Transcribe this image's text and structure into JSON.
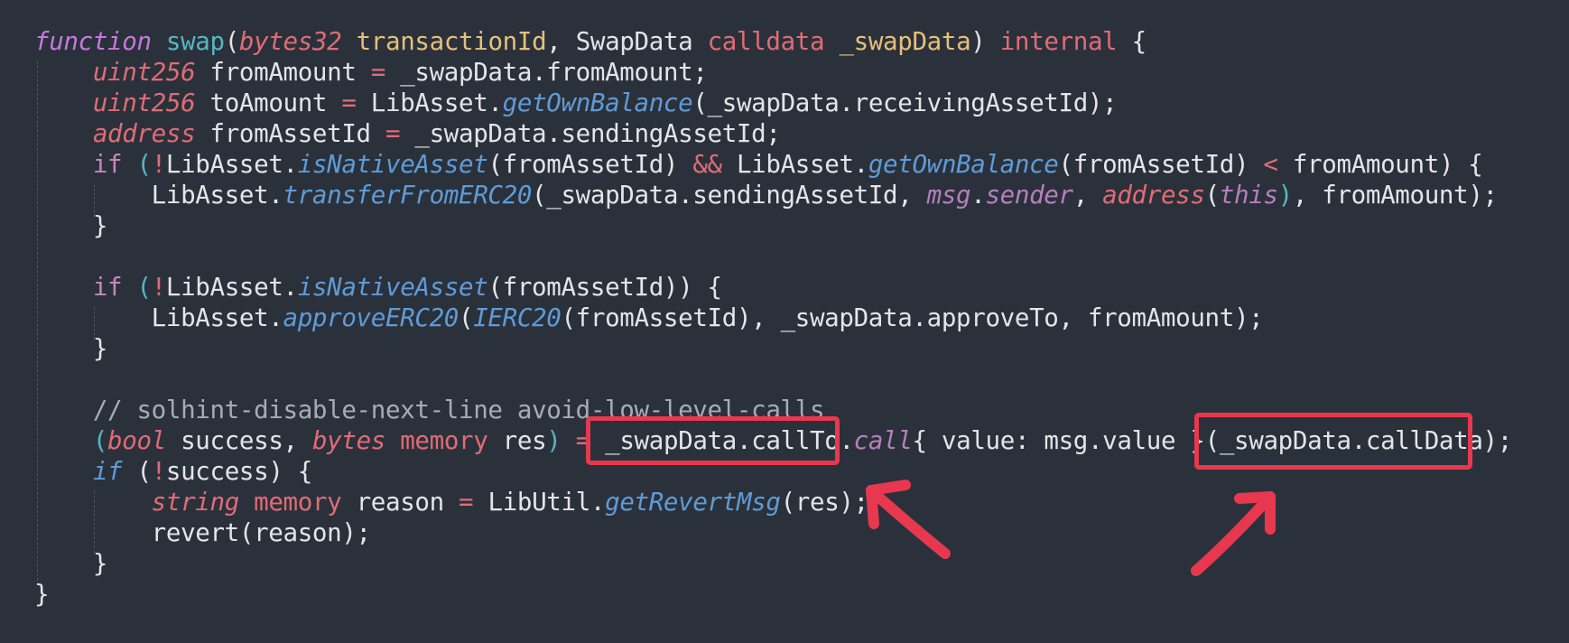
{
  "code": {
    "lines": [
      {
        "segments": [
          {
            "t": "function",
            "c": "t-kw-italic"
          },
          {
            "t": " ",
            "c": "t-plain"
          },
          {
            "t": "swap",
            "c": "t-fn"
          },
          {
            "t": "(",
            "c": "t-plain"
          },
          {
            "t": "bytes32",
            "c": "t-type"
          },
          {
            "t": " ",
            "c": "t-plain"
          },
          {
            "t": "transactionId",
            "c": "t-param"
          },
          {
            "t": ", SwapData ",
            "c": "t-plain"
          },
          {
            "t": "calldata",
            "c": "t-kw"
          },
          {
            "t": " ",
            "c": "t-plain"
          },
          {
            "t": "_swapData",
            "c": "t-param"
          },
          {
            "t": ") ",
            "c": "t-plain"
          },
          {
            "t": "internal",
            "c": "t-kw"
          },
          {
            "t": " {",
            "c": "t-plain"
          }
        ]
      },
      {
        "segments": [
          {
            "t": "    ",
            "c": "t-plain"
          },
          {
            "t": "uint256",
            "c": "t-type"
          },
          {
            "t": " fromAmount ",
            "c": "t-plain"
          },
          {
            "t": "=",
            "c": "t-op"
          },
          {
            "t": " _swapData.fromAmount;",
            "c": "t-plain"
          }
        ]
      },
      {
        "segments": [
          {
            "t": "    ",
            "c": "t-plain"
          },
          {
            "t": "uint256",
            "c": "t-type"
          },
          {
            "t": " toAmount ",
            "c": "t-plain"
          },
          {
            "t": "=",
            "c": "t-op"
          },
          {
            "t": " LibAsset.",
            "c": "t-plain"
          },
          {
            "t": "getOwnBalance",
            "c": "t-method"
          },
          {
            "t": "(_swapData.receivingAssetId);",
            "c": "t-plain"
          }
        ]
      },
      {
        "segments": [
          {
            "t": "    ",
            "c": "t-plain"
          },
          {
            "t": "address",
            "c": "t-type"
          },
          {
            "t": " fromAssetId ",
            "c": "t-plain"
          },
          {
            "t": "=",
            "c": "t-op"
          },
          {
            "t": " _swapData.sendingAssetId;",
            "c": "t-plain"
          }
        ]
      },
      {
        "segments": [
          {
            "t": "    ",
            "c": "t-plain"
          },
          {
            "t": "if",
            "c": "t-if"
          },
          {
            "t": " (",
            "c": "t-cyan"
          },
          {
            "t": "!",
            "c": "t-op"
          },
          {
            "t": "LibAsset.",
            "c": "t-plain"
          },
          {
            "t": "isNativeAsset",
            "c": "t-method"
          },
          {
            "t": "(fromAssetId) ",
            "c": "t-plain"
          },
          {
            "t": "&&",
            "c": "t-op"
          },
          {
            "t": " LibAsset.",
            "c": "t-plain"
          },
          {
            "t": "getOwnBalance",
            "c": "t-method"
          },
          {
            "t": "(fromAssetId) ",
            "c": "t-plain"
          },
          {
            "t": "<",
            "c": "t-op"
          },
          {
            "t": " fromAmount) {",
            "c": "t-plain"
          }
        ]
      },
      {
        "segments": [
          {
            "t": "        LibAsset.",
            "c": "t-plain"
          },
          {
            "t": "transferFromERC20",
            "c": "t-method"
          },
          {
            "t": "(_swapData.sendingAssetId, ",
            "c": "t-plain"
          },
          {
            "t": "msg",
            "c": "t-builtin"
          },
          {
            "t": ".",
            "c": "t-plain"
          },
          {
            "t": "sender",
            "c": "t-builtin"
          },
          {
            "t": ", ",
            "c": "t-plain"
          },
          {
            "t": "address",
            "c": "t-type"
          },
          {
            "t": "(",
            "c": "t-plain"
          },
          {
            "t": "this",
            "c": "t-builtin"
          },
          {
            "t": ")",
            "c": "t-cyan"
          },
          {
            "t": ", fromAmount);",
            "c": "t-plain"
          }
        ]
      },
      {
        "segments": [
          {
            "t": "    }",
            "c": "t-plain"
          }
        ]
      },
      {
        "segments": [
          {
            "t": "",
            "c": "t-plain"
          }
        ]
      },
      {
        "segments": [
          {
            "t": "    ",
            "c": "t-plain"
          },
          {
            "t": "if",
            "c": "t-if"
          },
          {
            "t": " (",
            "c": "t-cyan"
          },
          {
            "t": "!",
            "c": "t-op"
          },
          {
            "t": "LibAsset.",
            "c": "t-plain"
          },
          {
            "t": "isNativeAsset",
            "c": "t-method"
          },
          {
            "t": "(fromAssetId)) {",
            "c": "t-plain"
          }
        ]
      },
      {
        "segments": [
          {
            "t": "        LibAsset.",
            "c": "t-plain"
          },
          {
            "t": "approveERC20",
            "c": "t-method"
          },
          {
            "t": "(",
            "c": "t-plain"
          },
          {
            "t": "IERC20",
            "c": "t-method"
          },
          {
            "t": "(fromAssetId), _swapData.approveTo, fromAmount);",
            "c": "t-plain"
          }
        ]
      },
      {
        "segments": [
          {
            "t": "    }",
            "c": "t-plain"
          }
        ]
      },
      {
        "segments": [
          {
            "t": "",
            "c": "t-plain"
          }
        ]
      },
      {
        "segments": [
          {
            "t": "    ",
            "c": "t-plain"
          },
          {
            "t": "// solhint-disable-next-line avoid-low-level-calls",
            "c": "t-comment"
          }
        ]
      },
      {
        "segments": [
          {
            "t": "    ",
            "c": "t-plain"
          },
          {
            "t": "(",
            "c": "t-cyan"
          },
          {
            "t": "bool",
            "c": "t-type"
          },
          {
            "t": " success, ",
            "c": "t-plain"
          },
          {
            "t": "bytes",
            "c": "t-type"
          },
          {
            "t": " ",
            "c": "t-plain"
          },
          {
            "t": "memory",
            "c": "t-kw"
          },
          {
            "t": " res",
            "c": "t-plain"
          },
          {
            "t": ")",
            "c": "t-cyan"
          },
          {
            "t": " ",
            "c": "t-plain"
          },
          {
            "t": "=",
            "c": "t-op"
          },
          {
            "t": " _swapData.callTo.",
            "c": "t-plain"
          },
          {
            "t": "call",
            "c": "t-builtin"
          },
          {
            "t": "{ value: msg.value }(_swapData.callData);",
            "c": "t-plain"
          }
        ]
      },
      {
        "segments": [
          {
            "t": "    ",
            "c": "t-plain"
          },
          {
            "t": "if",
            "c": "t-ifit"
          },
          {
            "t": " (",
            "c": "t-plain"
          },
          {
            "t": "!",
            "c": "t-op"
          },
          {
            "t": "success) {",
            "c": "t-plain"
          }
        ]
      },
      {
        "segments": [
          {
            "t": "        ",
            "c": "t-plain"
          },
          {
            "t": "string",
            "c": "t-type"
          },
          {
            "t": " ",
            "c": "t-plain"
          },
          {
            "t": "memory",
            "c": "t-kw"
          },
          {
            "t": " reason ",
            "c": "t-plain"
          },
          {
            "t": "=",
            "c": "t-op"
          },
          {
            "t": " LibUtil.",
            "c": "t-plain"
          },
          {
            "t": "getRevertMsg",
            "c": "t-method"
          },
          {
            "t": "(res);",
            "c": "t-plain"
          }
        ]
      },
      {
        "segments": [
          {
            "t": "        revert(reason);",
            "c": "t-plain"
          }
        ]
      },
      {
        "segments": [
          {
            "t": "    }",
            "c": "t-plain"
          }
        ]
      },
      {
        "segments": [
          {
            "t": "}",
            "c": "t-plain"
          }
        ]
      }
    ]
  },
  "annotations": {
    "highlight_color": "#e8384f",
    "highlights": [
      {
        "name": "highlight-callTo",
        "target": "_swapData.callTo"
      },
      {
        "name": "highlight-callData",
        "target": "_swapData.callData"
      }
    ],
    "arrows": [
      {
        "name": "arrow-to-callTo",
        "direction": "up-left"
      },
      {
        "name": "arrow-to-callData",
        "direction": "up-right"
      }
    ]
  },
  "theme": {
    "background": "#2b313b"
  }
}
